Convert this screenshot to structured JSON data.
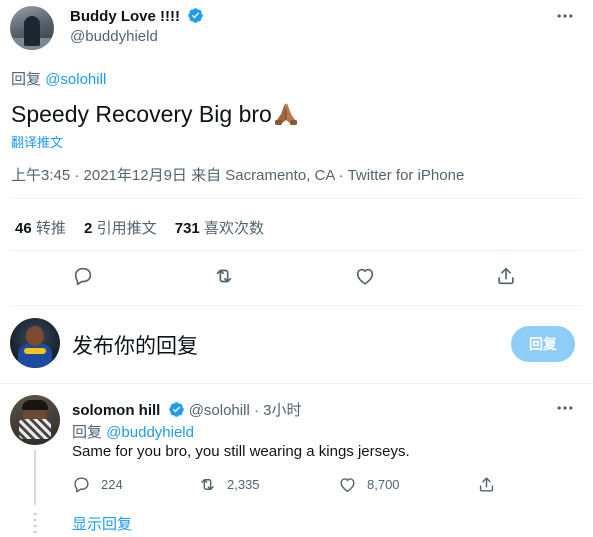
{
  "main_tweet": {
    "author_name": "Buddy Love !!!!",
    "author_handle": "@buddyhield",
    "reply_prefix": "回复",
    "reply_to": "@solohill",
    "text": "Speedy Recovery Big bro",
    "translate_label": "翻译推文",
    "timestamp": "上午3:45 · 2021年12月9日",
    "source_prefix": "来自",
    "location": "Sacramento, CA",
    "client": "Twitter for iPhone",
    "stats": {
      "retweets_count": "46",
      "retweets_label": "转推",
      "quotes_count": "2",
      "quotes_label": "引用推文",
      "likes_count": "731",
      "likes_label": "喜欢次数"
    }
  },
  "composer": {
    "placeholder": "发布你的回复",
    "reply_button_label": "回复"
  },
  "reply_tweet": {
    "author_name": "solomon hill",
    "author_handle": "@solohill",
    "separator": "·",
    "time_ago": "3小时",
    "reply_prefix": "回复",
    "reply_to": "@buddyhield",
    "text": "Same for you bro, you still wearing a kings jerseys.",
    "replies_count": "224",
    "retweets_count": "2,335",
    "likes_count": "8,700",
    "show_replies_label": "显示回复"
  },
  "colors": {
    "accent": "#1d9bf0",
    "text": "#0f1419",
    "secondary_text": "#536471",
    "divider": "#eff3f4",
    "reply_button_bg": "#8ecdf8"
  },
  "icons": [
    "verified-badge-icon",
    "more-icon",
    "reply-icon",
    "retweet-icon",
    "like-icon",
    "share-icon",
    "folded-hands-emoji"
  ]
}
